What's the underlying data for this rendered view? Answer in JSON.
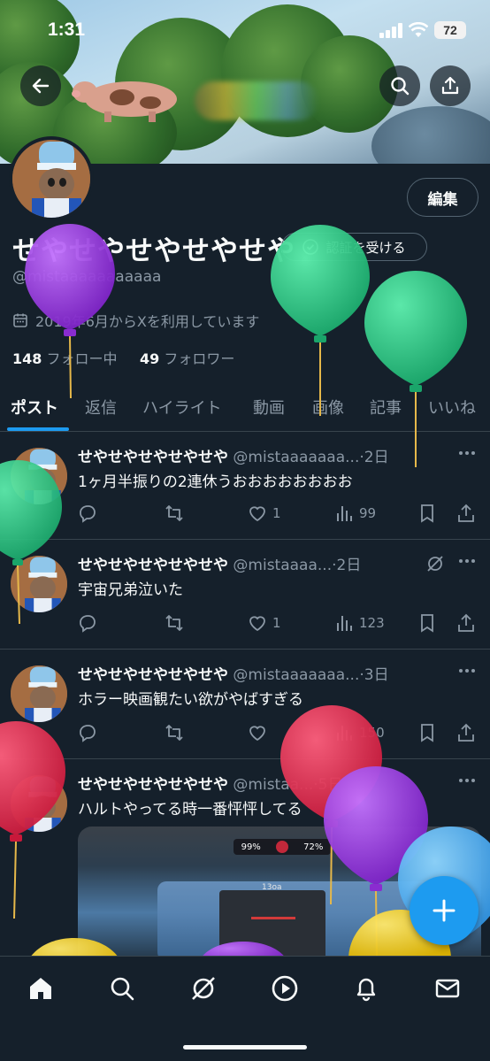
{
  "status_bar": {
    "time": "1:31",
    "battery": "72"
  },
  "profile": {
    "display_name": "せやせやせやせやせや",
    "handle": "@mistaaaaaaaaaaa",
    "edit_label": "編集",
    "verify_label": "認証を受ける",
    "joined": "2019年6月からXを利用しています",
    "following_count": "148",
    "following_label": "フォロー中",
    "followers_count": "49",
    "followers_label": "フォロワー"
  },
  "tabs": [
    {
      "label": "ポスト"
    },
    {
      "label": "返信"
    },
    {
      "label": "ハイライト"
    },
    {
      "label": "動画"
    },
    {
      "label": "画像"
    },
    {
      "label": "記事"
    },
    {
      "label": "いいね"
    }
  ],
  "posts": [
    {
      "name": "せやせやせやせやせや",
      "handle": "@mistaaaaaaa...",
      "time": "2日",
      "text": "1ヶ月半振りの2連休うおおおおおおおお",
      "likes": "1",
      "views": "99"
    },
    {
      "name": "せやせやせやせやせや",
      "handle": "@mistaaaa...",
      "time": "2日",
      "text": "宇宙兄弟泣いた",
      "likes": "1",
      "views": "123"
    },
    {
      "name": "せやせやせやせやせや",
      "handle": "@mistaaaaaaa...",
      "time": "3日",
      "text": "ホラー映画観たい欲がやばすぎる",
      "likes": "",
      "views": "150"
    },
    {
      "name": "せやせやせやせやせや",
      "handle": "@mistaa...",
      "time": "5日",
      "text": "ハルトやってる時一番怦怦してる",
      "likes": "",
      "views": ""
    }
  ],
  "media": {
    "hud_health": "99%",
    "hud_ammo": "72%",
    "hud_top": "13oa"
  },
  "icons": {
    "back": "back-arrow-icon",
    "search": "search-icon",
    "share": "share-icon",
    "edit": "edit-button",
    "calendar": "calendar-icon",
    "reply": "reply-icon",
    "repost": "repost-icon",
    "like": "heart-icon",
    "views": "views-icon",
    "bookmark": "bookmark-icon",
    "more": "more-icon",
    "grok": "grok-icon",
    "home": "home-icon",
    "explore": "search-icon",
    "video": "play-icon",
    "notifications": "bell-icon",
    "messages": "mail-icon",
    "compose": "plus-icon"
  },
  "colors": {
    "background": "#15202b",
    "accent": "#1d9bf0",
    "muted": "#8b98a5",
    "border": "#38444d"
  }
}
